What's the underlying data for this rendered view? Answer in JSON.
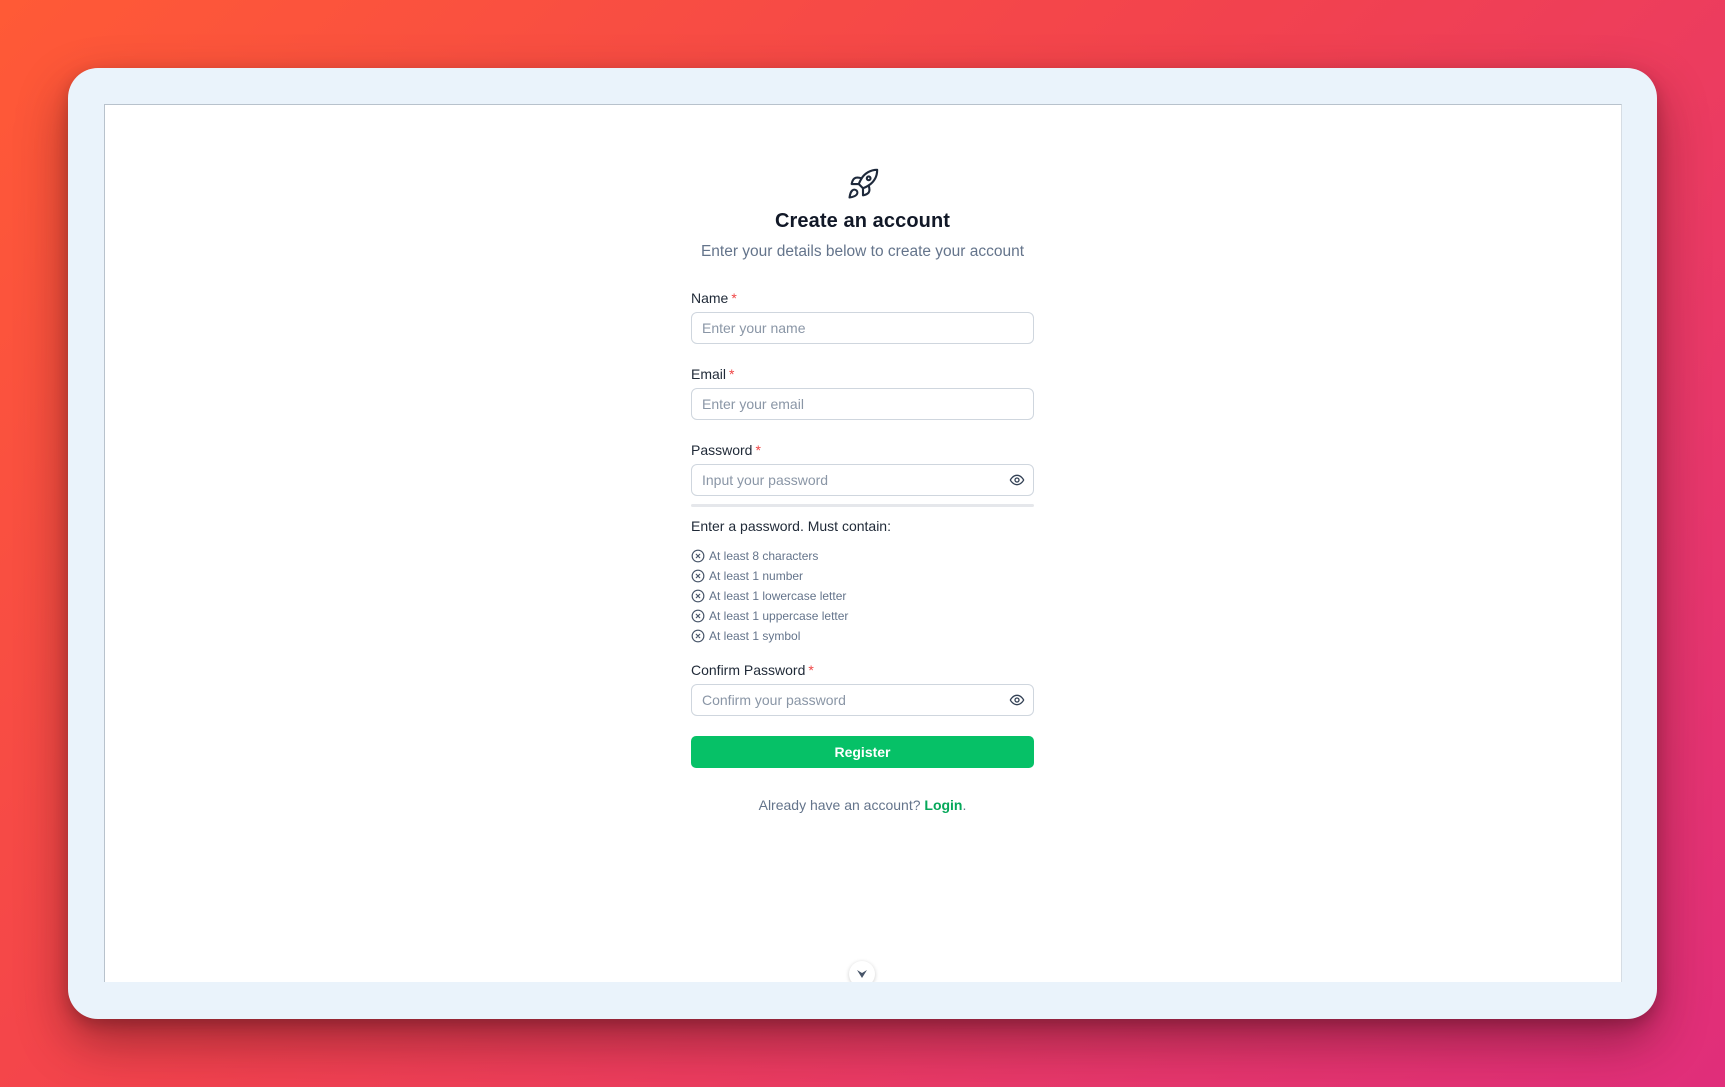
{
  "header": {
    "title": "Create an account",
    "subtitle": "Enter your details below to create your account",
    "logo_icon": "rocket-icon"
  },
  "fields": {
    "name": {
      "label": "Name",
      "required_mark": "*",
      "placeholder": "Enter your name",
      "value": ""
    },
    "email": {
      "label": "Email",
      "required_mark": "*",
      "placeholder": "Enter your email",
      "value": ""
    },
    "password": {
      "label": "Password",
      "required_mark": "*",
      "placeholder": "Input your password",
      "value": "",
      "toggle_icon": "eye-icon"
    },
    "confirm_password": {
      "label": "Confirm Password",
      "required_mark": "*",
      "placeholder": "Confirm your password",
      "value": "",
      "toggle_icon": "eye-icon"
    }
  },
  "password_requirements": {
    "title": "Enter a password. Must contain:",
    "status_icon": "x-circle-icon",
    "strength": 0,
    "items": [
      "At least 8 characters",
      "At least 1 number",
      "At least 1 lowercase letter",
      "At least 1 uppercase letter",
      "At least 1 symbol"
    ]
  },
  "actions": {
    "register_label": "Register",
    "login_prompt": "Already have an account?",
    "login_link": "Login",
    "login_suffix": "."
  },
  "colors": {
    "accent": "#06c167",
    "link": "#06a85a",
    "required": "#ef4444"
  },
  "scroll_icon": "chevron-down-icon"
}
